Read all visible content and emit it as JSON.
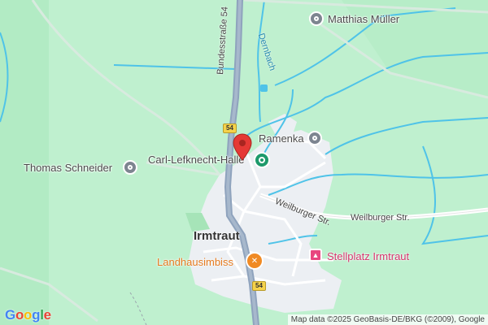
{
  "map": {
    "labels": {
      "matthias_mueller": "Matthias Müller",
      "ramenka": "Ramenka",
      "carl_lefknecht_halle": "Carl-Lefknecht-Halle",
      "thomas_schneider": "Thomas Schneider",
      "irmtraut": "Irmtraut",
      "landhausimbiss": "Landhausimbiss",
      "stellplatz_irmtraut": "Stellplatz Irmtraut",
      "weilburger_str_1": "Weilburger Str.",
      "weilburger_str_2": "Weilburger Str.",
      "bundesstrasse": "Bundesstraße 54",
      "dernbach": "Dernbach"
    },
    "route_shields": {
      "north": "54",
      "south": "54"
    },
    "icons": {
      "matthias_mueller": "place-pin-icon",
      "ramenka": "place-pin-icon",
      "carl_lefknecht_halle": "venue-pin-icon",
      "thomas_schneider": "place-pin-icon",
      "landhausimbiss": "restaurant-icon",
      "stellplatz_irmtraut": "camping-icon",
      "selected": "red-marker-icon"
    },
    "colors": {
      "land": "#bff0cf",
      "water": "#4fc3e8",
      "main_road": "#8fa3bd",
      "settlement": "#eceff3",
      "marker": "#e53935",
      "food": "#e57a1f",
      "camping": "#d6336c",
      "venue": "#1e9a6b"
    },
    "logo": "Google",
    "attribution": "Map data ©2025 GeoBasis-DE/BKG (©2009), Google"
  }
}
